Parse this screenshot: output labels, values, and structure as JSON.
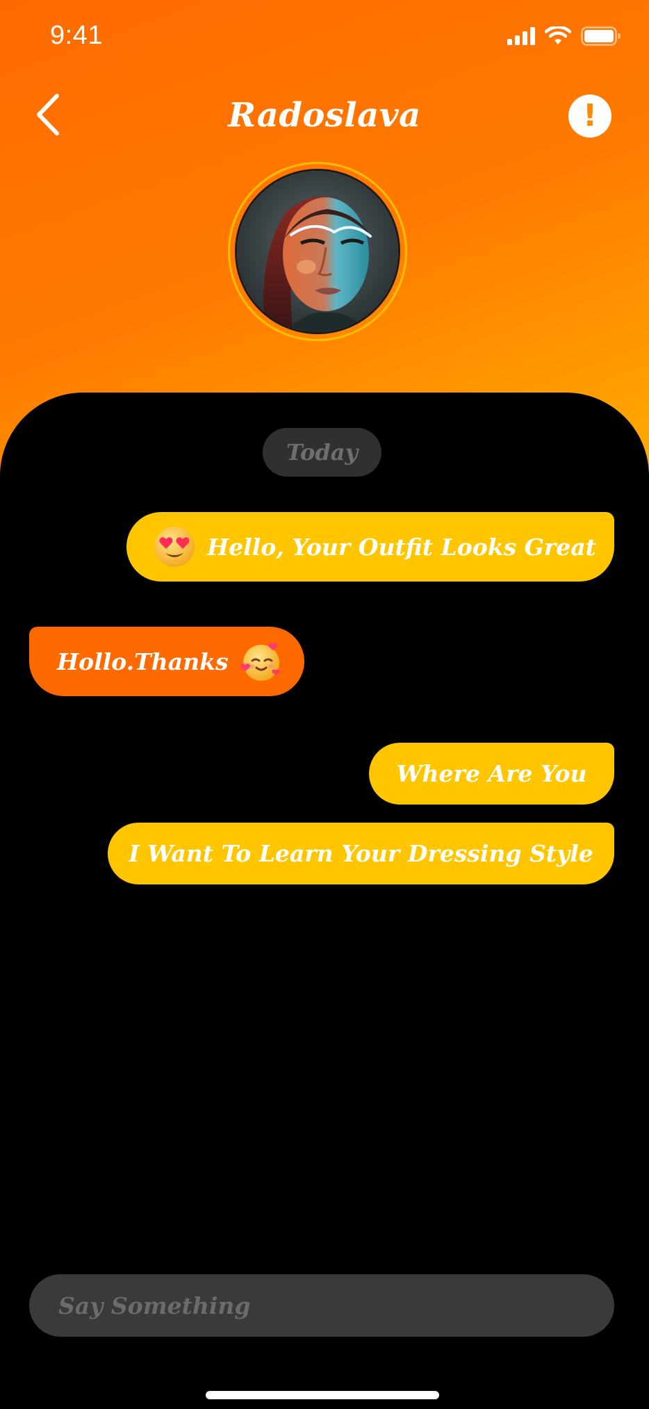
{
  "status_bar": {
    "time": "9:41",
    "icons": [
      "signal-icon",
      "wifi-icon",
      "battery-icon"
    ]
  },
  "header": {
    "title": "Radoslava",
    "back_icon": "chevron-left-icon",
    "alert_icon": "exclamation-icon",
    "alert_glyph": "!"
  },
  "chat": {
    "date_label": "Today",
    "messages": [
      {
        "direction": "sent",
        "text": "Hello, Your Outfit Looks Great",
        "emoji": "heart-eyes-emoji"
      },
      {
        "direction": "received",
        "text": "Hollo.Thanks",
        "emoji": "smiling-face-with-hearts-emoji"
      },
      {
        "direction": "sent",
        "text": "Where Are You"
      },
      {
        "direction": "sent",
        "text": "I Want To Learn Your Dressing Style"
      }
    ]
  },
  "composer": {
    "placeholder": "Say Something",
    "value": ""
  },
  "colors": {
    "gradient_top": "#ff6a00",
    "gradient_bottom": "#ffcf00",
    "sent_bubble": "#ffc600",
    "received_bubble": "#ff6a00",
    "panel": "#000000",
    "pill": "#303030"
  }
}
